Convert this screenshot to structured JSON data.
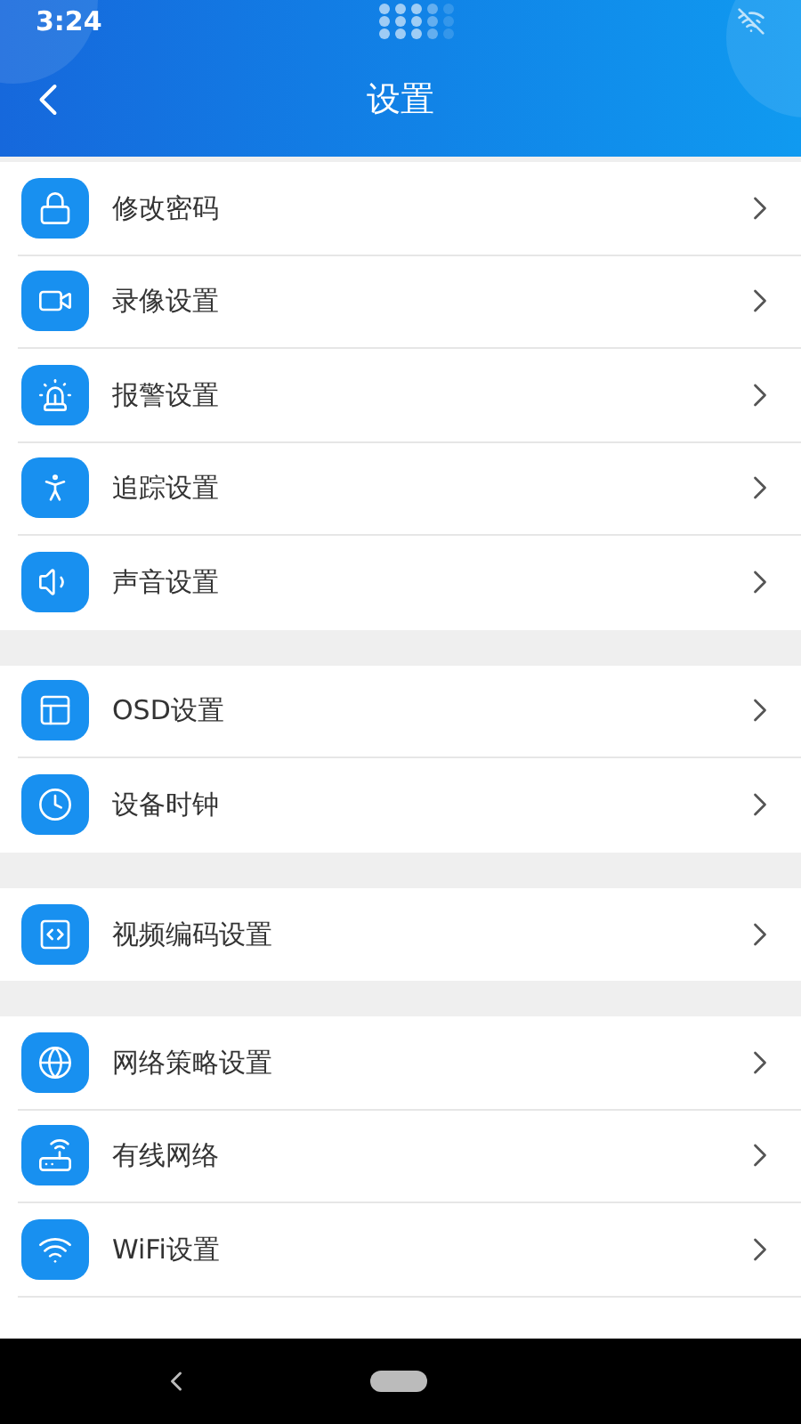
{
  "status_bar": {
    "time": "3:24"
  },
  "header": {
    "title": "设置"
  },
  "groups": [
    {
      "items": [
        {
          "label": "修改密码"
        },
        {
          "label": "录像设置"
        },
        {
          "label": "报警设置"
        },
        {
          "label": "追踪设置"
        },
        {
          "label": "声音设置"
        }
      ]
    },
    {
      "items": [
        {
          "label": "OSD设置"
        },
        {
          "label": "设备时钟"
        }
      ]
    },
    {
      "items": [
        {
          "label": "视频编码设置"
        }
      ]
    },
    {
      "items": [
        {
          "label": "网络策略设置"
        },
        {
          "label": "有线网络"
        },
        {
          "label": "WiFi设置"
        }
      ]
    }
  ]
}
